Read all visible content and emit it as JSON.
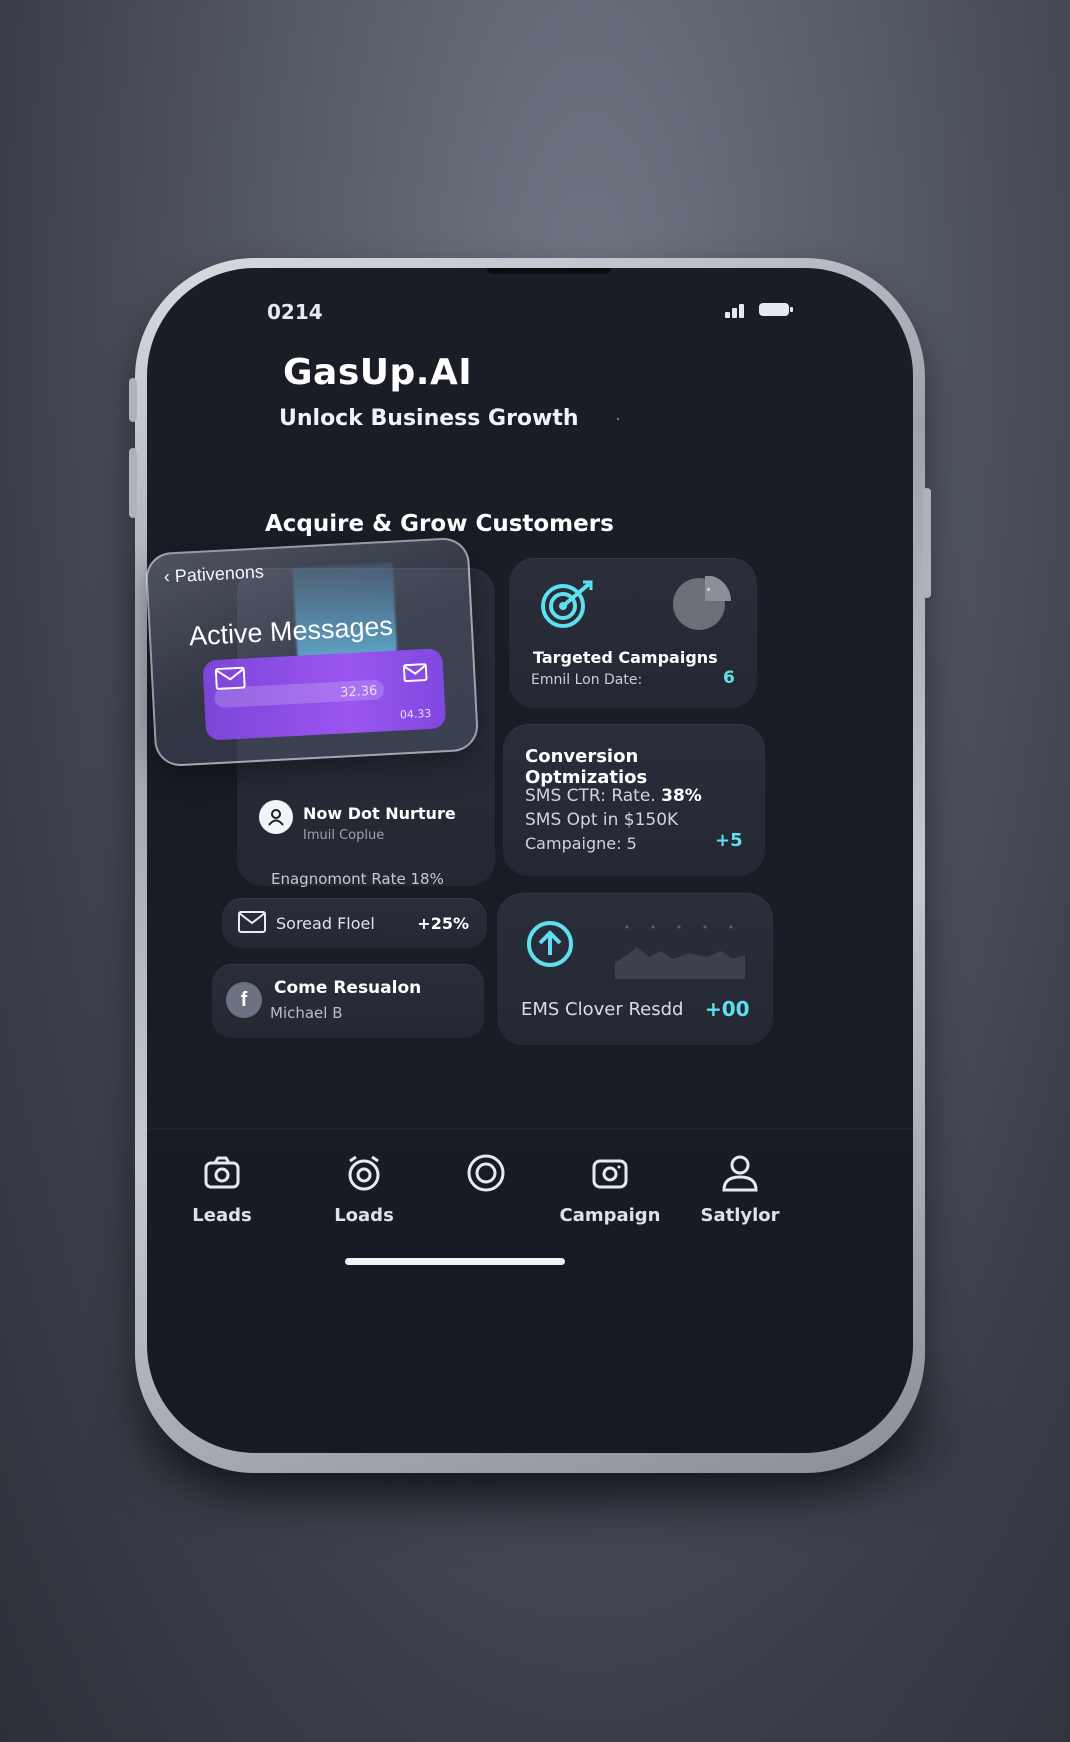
{
  "status": {
    "time": "0214"
  },
  "app": {
    "title": "GasUp.AI",
    "subtitle": "Unlock Business Growth"
  },
  "section": {
    "title": "Acquire & Grow Customers"
  },
  "overlay": {
    "back_label": "Pativenons",
    "title": "Active Messages",
    "amount": "32.36",
    "code": "04.33"
  },
  "nurture": {
    "title": "Now Dot Nurture",
    "subtitle": "Imuil Coplue",
    "engagement": "Enagnomont Rate 18%"
  },
  "spread": {
    "label": "Soread Floel",
    "delta": "+25%"
  },
  "resolution": {
    "title": "Come Resualon",
    "subtitle": "Michael B"
  },
  "targeted": {
    "title": "Targeted Campaigns",
    "subtitle": "Emnil Lon Date:",
    "count": "6"
  },
  "conversion": {
    "title": "Conversion Optmizatios",
    "line1_label": "SMS CTR: Rate.",
    "line1_value": "38%",
    "line2": "SMS Opt in $150K",
    "line3": "Campaigne: 5",
    "delta": "+5"
  },
  "ems": {
    "label": "EMS Clover Resdd",
    "delta": "+00"
  },
  "nav": [
    {
      "label": "Leads",
      "icon": "camera-icon"
    },
    {
      "label": "Loads",
      "icon": "alarm-icon"
    },
    {
      "label": "",
      "icon": "circle-target-icon"
    },
    {
      "label": "Campaign",
      "icon": "camera-icon"
    },
    {
      "label": "Satlylor",
      "icon": "user-icon"
    }
  ],
  "colors": {
    "accent": "#5fe0ef",
    "purple": "#9b55f0",
    "background": "#1a1d26"
  }
}
